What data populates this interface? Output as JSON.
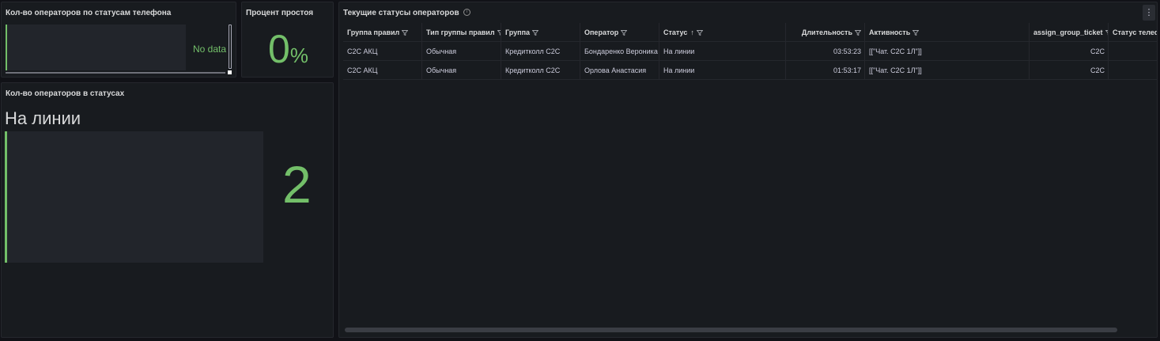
{
  "panels": {
    "phone_status": {
      "title": "Кол-во операторов по статусам телефона",
      "no_data": "No data"
    },
    "idle_percent": {
      "title": "Процент простоя",
      "value": "0",
      "unit": "%"
    },
    "operators_in_status": {
      "title": "Кол-во операторов в статусах",
      "status_label": "На линии",
      "count": "2"
    },
    "current_statuses": {
      "title": "Текущие статусы операторов",
      "columns": [
        {
          "label": "Группа правил"
        },
        {
          "label": "Тип группы правил"
        },
        {
          "label": "Группа"
        },
        {
          "label": "Оператор"
        },
        {
          "label": "Статус",
          "sort_icon": "↑"
        },
        {
          "label": "Длительность"
        },
        {
          "label": "Активность"
        },
        {
          "label": "assign_group_ticket"
        },
        {
          "label": "Статус телефона"
        }
      ],
      "rows": [
        [
          "C2C АКЦ",
          "Обычная",
          "Кредитколл C2C",
          "Бондаренко Вероника",
          "На линии",
          "03:53:23",
          "[[\"Чат. C2C 1Л\"]]",
          "C2C",
          ""
        ],
        [
          "C2C АКЦ",
          "Обычная",
          "Кредитколл C2C",
          "Орлова Анастасия",
          "На линии",
          "01:53:17",
          "[[\"Чат. C2C 1Л\"]]",
          "C2C",
          ""
        ]
      ]
    }
  },
  "icons": {
    "info": "info-icon",
    "menu": "kebab-menu-icon",
    "filter": "filter-icon",
    "sort": "sort-ascending-icon"
  },
  "colors": {
    "background": "#111217",
    "panel": "#181b1f",
    "accent_green": "#73bf69",
    "text": "#ccccdc"
  }
}
